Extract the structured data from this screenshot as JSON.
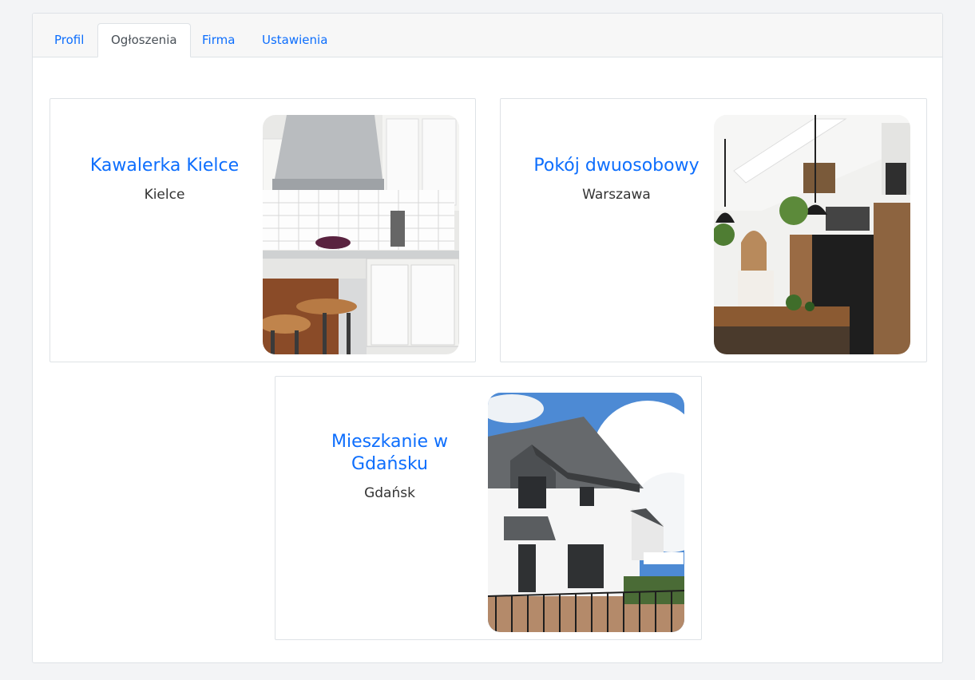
{
  "tabs": [
    {
      "label": "Profil",
      "active": false
    },
    {
      "label": "Ogłoszenia",
      "active": true
    },
    {
      "label": "Firma",
      "active": false
    },
    {
      "label": "Ustawienia",
      "active": false
    }
  ],
  "listings": [
    {
      "title": "Kawalerka Kielce",
      "city": "Kielce",
      "image": "kitchen-photo"
    },
    {
      "title": "Pokój dwuosobowy",
      "city": "Warszawa",
      "image": "loft-kitchen-photo"
    },
    {
      "title": "Mieszkanie w Gdańsku",
      "city": "Gdańsk",
      "image": "house-photo"
    }
  ],
  "colors": {
    "accent": "#0d6efd",
    "border": "#dee2e6",
    "background": "#f3f4f6"
  }
}
